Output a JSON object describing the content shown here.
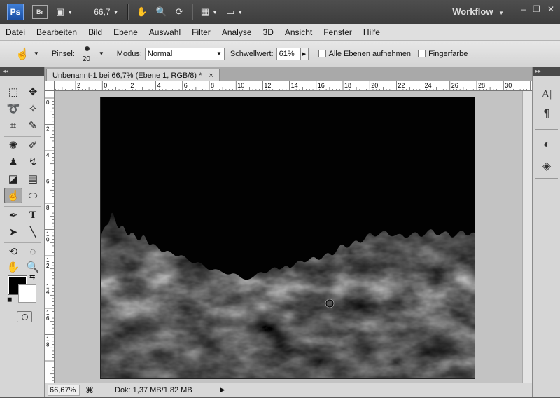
{
  "app": {
    "logo": "Ps",
    "bridge": "Br",
    "zoom": "66,7",
    "workspace": "Workflow",
    "icons": [
      "camera-raw-icon",
      "hand-icon",
      "zoom-icon",
      "rotate-view-icon",
      "arrange-icon",
      "screen-mode-icon"
    ]
  },
  "menu": [
    "Datei",
    "Bearbeiten",
    "Bild",
    "Ebene",
    "Auswahl",
    "Filter",
    "Analyse",
    "3D",
    "Ansicht",
    "Fenster",
    "Hilfe"
  ],
  "options": {
    "brush_label": "Pinsel:",
    "brush_size": "20",
    "mode_label": "Modus:",
    "mode_value": "Normal",
    "threshold_label": "Schwellwert:",
    "threshold_value": "61%",
    "all_layers_label": "Alle Ebenen aufnehmen",
    "finger_paint_label": "Fingerfarbe"
  },
  "document": {
    "tab_title": "Unbenannt-1 bei 66,7% (Ebene 1, RGB/8) *",
    "close": "×"
  },
  "rulers": {
    "top": [
      "2",
      "0",
      "2",
      "4",
      "6",
      "8",
      "10",
      "12",
      "14",
      "16",
      "18",
      "20",
      "22",
      "24",
      "26",
      "28",
      "30"
    ],
    "left": [
      "0",
      "2",
      "4",
      "6",
      "8",
      "10",
      "12",
      "14",
      "16",
      "18"
    ]
  },
  "status": {
    "zoom": "66,67%",
    "doc": "Dok: 1,37 MB/1,82 MB"
  },
  "colors": {
    "foreground": "#000000",
    "background": "#ffffff"
  },
  "panels": {
    "right_icons": [
      "character-icon",
      "paragraph-icon",
      "adjustments-icon",
      "layers-icon"
    ]
  }
}
